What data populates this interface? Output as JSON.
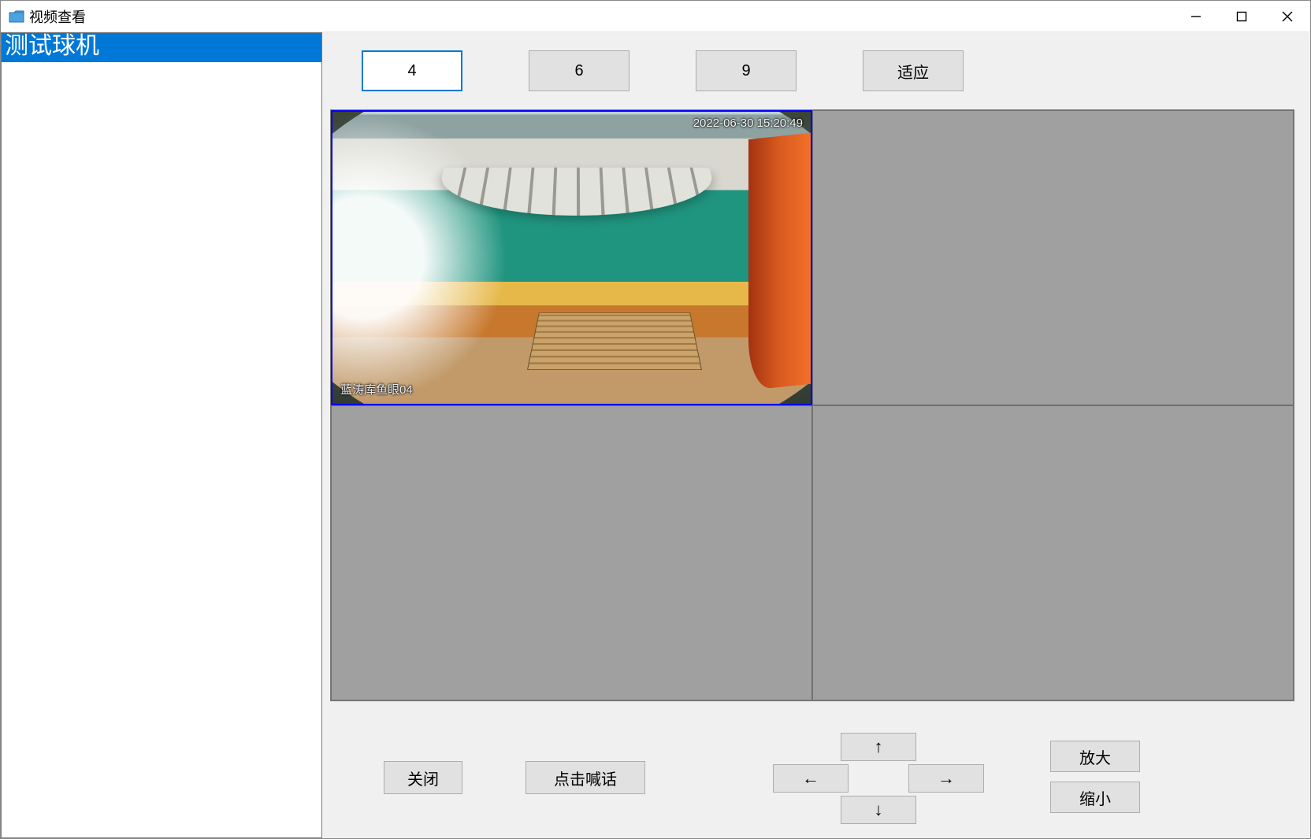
{
  "window": {
    "title": "视频查看"
  },
  "sidebar": {
    "items": [
      {
        "label": "测试球机"
      }
    ]
  },
  "toolbar": {
    "layout4": "4",
    "layout6": "6",
    "layout9": "9",
    "fit": "适应"
  },
  "feed": {
    "osd_timestamp": "2022-06-30 15:20:49",
    "osd_camera_name": "蓝涛库鱼眼04"
  },
  "controls": {
    "close": "关闭",
    "talk": "点击喊话",
    "up": "↑",
    "down": "↓",
    "left": "←",
    "right": "→",
    "zoom_in": "放大",
    "zoom_out": "缩小"
  }
}
